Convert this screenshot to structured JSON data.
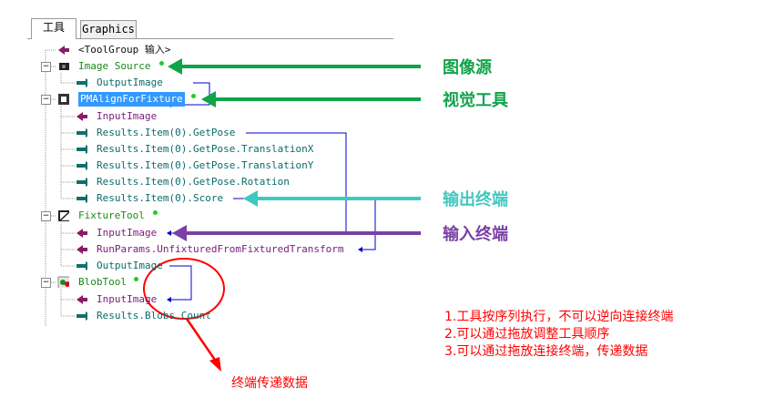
{
  "tabs": [
    "工具",
    "Graphics"
  ],
  "tree": {
    "toolgroup": "<ToolGroup 输入>",
    "image_source": "Image Source",
    "image_source_output": "OutputImage",
    "pmalign": "PMAlignForFixture",
    "pmalign_items": [
      "InputImage",
      "Results.Item(0).GetPose",
      "Results.Item(0).GetPose.TranslationX",
      "Results.Item(0).GetPose.TranslationY",
      "Results.Item(0).GetPose.Rotation",
      "Results.Item(0).Score"
    ],
    "fixture": "FixtureTool",
    "fixture_items": [
      "InputImage",
      "RunParams.UnfixturedFromFixturedTransform",
      "OutputImage"
    ],
    "blob": "BlobTool",
    "blob_items": [
      "InputImage",
      "Results.Blobs.Count"
    ]
  },
  "callouts": {
    "image_source": "图像源",
    "vision_tool": "视觉工具",
    "output_terminal": "输出终端",
    "input_terminal": "输入终端",
    "data_transfer": "终端传递数据"
  },
  "notes": [
    "1.工具按序列执行，不可以逆向连接终端",
    "2.可以通过拖放调整工具顺序",
    "3.可以通过拖放连接终端，传递数据"
  ],
  "colors": {
    "green_arrow": "#10a34a",
    "teal_arrow": "#40c8c0",
    "purple_arrow": "#7b3fa6",
    "red": "#ff0000",
    "link_blue": "#0000cc"
  }
}
